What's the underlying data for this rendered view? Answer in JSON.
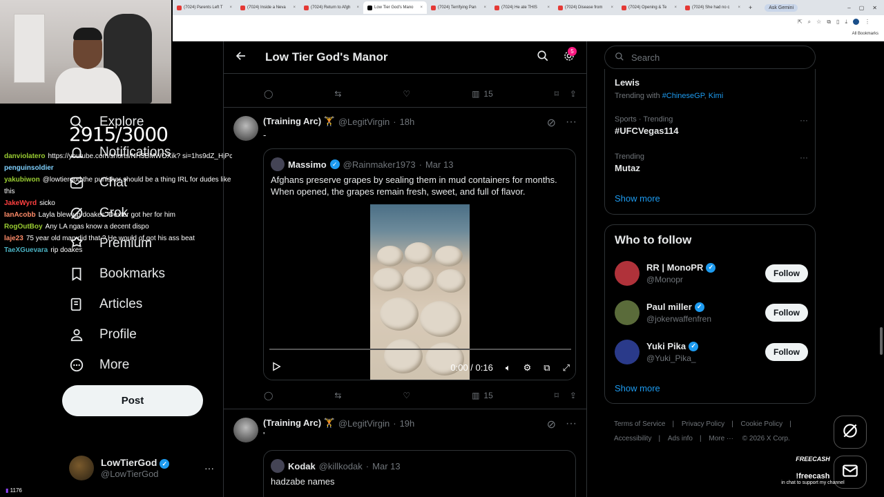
{
  "browser": {
    "tabs": [
      {
        "label": "(7024) Parents Left T"
      },
      {
        "label": "(7024) Inside a Neva"
      },
      {
        "label": "(7024) Return to Afgh"
      },
      {
        "label": "Low Tier God's Mano",
        "active": true
      },
      {
        "label": "(7024) Terrifying Pan"
      },
      {
        "label": "(7024) He ate THIS"
      },
      {
        "label": "(7024) Disease from"
      },
      {
        "label": "(7024) Opening & Te"
      },
      {
        "label": "(7024) She had no c"
      }
    ],
    "ask_gemini": "Ask Gemini",
    "all_bookmarks": "All Bookmarks"
  },
  "overlay": {
    "counter": "2915/3000",
    "viewers": "1176",
    "chat": [
      {
        "user": "danviolatero",
        "text": "https://youtube.com/shorts/NH3BMWOXik? si=1hs9dZ_HjPcmzBC",
        "color": "#9acd32"
      },
      {
        "user": "penguinsoldier",
        "text": "",
        "color": "#7fd1ff"
      },
      {
        "user": "yakubiwon",
        "text": "@lowtiergod the punisher should be a thing IRL for dudes like this",
        "color": "#9acd32"
      },
      {
        "user": "JakeWyrd",
        "text": "sicko",
        "color": "#ff4040"
      },
      {
        "user": "IanAcobb",
        "text": "Layla blew up doakes. Dexter got her for him",
        "color": "#ff8c69"
      },
      {
        "user": "RogOutBoy",
        "text": "Any LA ngas know a decent dispo",
        "color": "#9acd32"
      },
      {
        "user": "laje23",
        "text": "75 year old man did that ? He would of got his ass beat",
        "color": "#ff8c69"
      },
      {
        "user": "TaeXGuevara",
        "text": "rip doakes",
        "color": "#4ab0c0"
      }
    ]
  },
  "nav": {
    "items": [
      {
        "label": "Explore",
        "icon": "search-icon"
      },
      {
        "label": "Notifications",
        "icon": "bell-icon"
      },
      {
        "label": "Chat",
        "icon": "chat-icon"
      },
      {
        "label": "Grok",
        "icon": "grok-icon"
      },
      {
        "label": "Premium",
        "icon": "premium-icon"
      },
      {
        "label": "Bookmarks",
        "icon": "bookmark-icon"
      },
      {
        "label": "Articles",
        "icon": "articles-icon"
      },
      {
        "label": "Profile",
        "icon": "profile-icon"
      },
      {
        "label": "More",
        "icon": "more-icon"
      }
    ],
    "post_label": "Post",
    "account": {
      "name": "LowTierGod",
      "handle": "@LowTierGod"
    }
  },
  "main": {
    "title": "Low Tier God's Manor",
    "settings_badge": "5",
    "top_actions": {
      "views": "15"
    },
    "tweet1": {
      "name": "(Training Arc) 🏋",
      "handle": "@LegitVirgin",
      "time": "18h",
      "text": "-",
      "quote": {
        "name": "Massimo",
        "handle": "@Rainmaker1973",
        "date": "Mar 13",
        "text": "Afghans preserve grapes by sealing them in mud containers for months. When opened, the grapes remain fresh, sweet, and full of flavor."
      },
      "video": {
        "time": "0:00 / 0:16"
      },
      "views": "15"
    },
    "tweet2": {
      "name": "(Training Arc) 🏋",
      "handle": "@LegitVirgin",
      "time": "19h",
      "text": "'",
      "quote": {
        "name": "Kodak",
        "handle": "@killkodak",
        "date": "Mar 13",
        "text": "hadzabe names"
      }
    }
  },
  "right": {
    "search_placeholder": "Search",
    "trends": [
      {
        "category": "",
        "title": "Lewis",
        "extra_prefix": "Trending with",
        "extra": [
          "#ChineseGP",
          "Kimi"
        ]
      },
      {
        "category": "Sports · Trending",
        "title": "#UFCVegas114"
      },
      {
        "category": "Trending",
        "title": "Mutaz"
      }
    ],
    "show_more": "Show more",
    "who_to_follow": {
      "title": "Who to follow",
      "users": [
        {
          "name": "RR | MonoPR",
          "handle": "@Monopr",
          "color": "#b0323a"
        },
        {
          "name": "Paul miller",
          "handle": "@jokerwaffenfren",
          "color": "#5a6b3a"
        },
        {
          "name": "Yuki Pika",
          "handle": "@Yuki_Pika_",
          "color": "#2a3a8a"
        }
      ],
      "follow_label": "Follow",
      "show_more": "Show more"
    },
    "footer": [
      "Terms of Service",
      "Privacy Policy",
      "Cookie Policy",
      "Accessibility",
      "Ads info",
      "More ···",
      "© 2026 X Corp."
    ],
    "freecash": {
      "brand": "FREECASH",
      "cmd": "!freecash",
      "sub": "in chat to support my channel"
    }
  },
  "colors": {
    "accent": "#1d9bf0",
    "background": "#000000",
    "border": "#2f3336",
    "muted": "#71767b"
  }
}
